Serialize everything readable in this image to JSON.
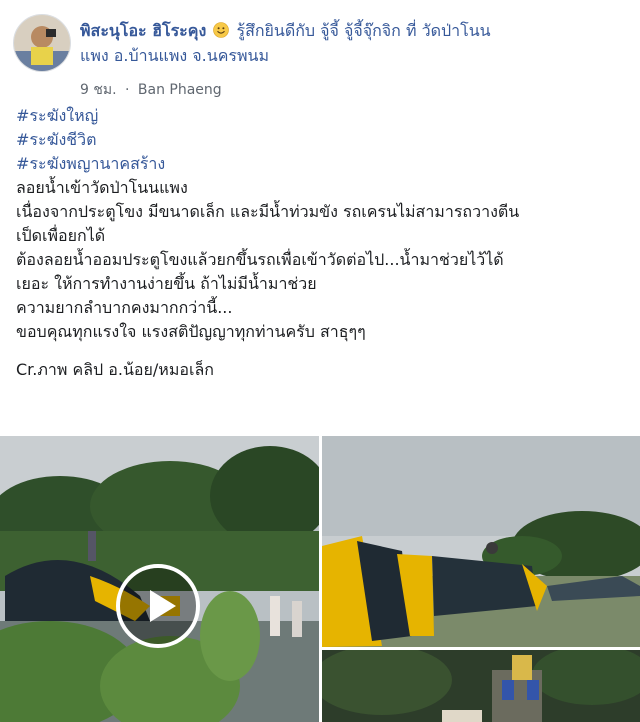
{
  "post": {
    "author": "พิสะนุโอะ ฮิโระคุง",
    "feeling": "รู้สึกยินดีกับ จู้จี้ จู้จี้จุ๊กจิก ที่ วัดป่าโนนแพง อ.บ้านแพง จ.นครพนม",
    "feeling_line1": "รู้สึกยินดีกับ จู้จี้ จู้จี้จุ๊กจิก ที่ วัดป่าโนน",
    "feeling_line2": "แพง อ.บ้านแพง จ.นครพนม",
    "timestamp": "9 ชม.",
    "separator": "·",
    "location": "Ban Phaeng",
    "hashtags": [
      "#ระฆังใหญ่",
      "#ระฆังชีวิต",
      "#ระฆังพญานาคสร้าง"
    ],
    "lines": [
      "ลอยน้ำเข้าวัดป่าโนนแพง",
      "เนื่องจากประตูโขง มีขนาดเล็ก และมีน้ำท่วมขัง รถเครนไม่สามารถวางตีน",
      "เป็ดเพื่อยกได้",
      "ต้องลอยน้ำออมประตูโขงแล้วยกขึ้นรถเพื่อเข้าวัดต่อไป...น้ำมาช่วยไว้ได้",
      "เยอะ ให้การทำงานง่ายขึ้น ถ้าไม่มีน้ำมาช่วย",
      "ความยากลำบากคงมากกว่านี้...",
      "ขอบคุณทุกแรงใจ แรงสติปัญญาทุกท่านครับ สาธุๆๆ"
    ],
    "credit": "Cr.ภาพ คลิป อ.น้อย/หมอเล็ก"
  },
  "icons": {
    "emoji": "smiley-emoji-icon",
    "globe": "globe-icon",
    "play": "play-icon"
  },
  "colors": {
    "link": "#365899",
    "text": "#1c1e21",
    "meta": "#606770",
    "bell_gold": "#e6b400",
    "bell_dark": "#1f2a33"
  }
}
